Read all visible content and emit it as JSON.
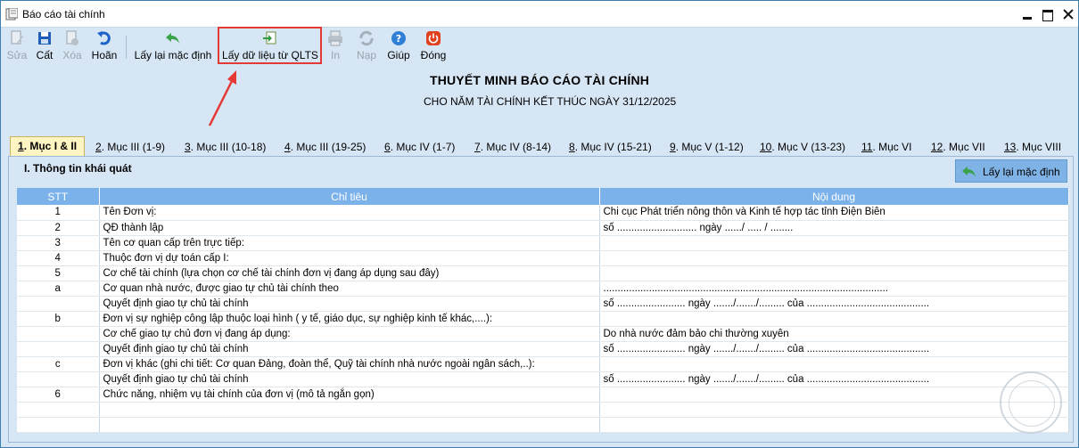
{
  "window": {
    "title": "Báo cáo tài chính"
  },
  "toolbar": {
    "edit": "Sửa",
    "save": "Cất",
    "delete": "Xóa",
    "undo": "Hoãn",
    "reset_default": "Lấy lại mặc định",
    "import_qlts": "Lấy dữ liệu từ QLTS",
    "print": "In",
    "load": "Nạp",
    "help": "Giúp",
    "close": "Đóng"
  },
  "report": {
    "title": "THUYẾT MINH BÁO CÁO TÀI CHÍNH",
    "subtitle": "CHO NĂM TÀI CHÍNH KẾT THÚC NGÀY 31/12/2025"
  },
  "tabs": [
    {
      "key": "1",
      "label": ". Mục I & II"
    },
    {
      "key": "2",
      "label": ". Mục III (1-9)"
    },
    {
      "key": "3",
      "label": ". Mục III (10-18)"
    },
    {
      "key": "4",
      "label": ". Mục III (19-25)"
    },
    {
      "key": "6",
      "label": ". Mục IV (1-7)"
    },
    {
      "key": "7",
      "label": ". Mục IV (8-14)"
    },
    {
      "key": "8",
      "label": ". Mục IV (15-21)"
    },
    {
      "key": "9",
      "label": ". Mục V (1-12)"
    },
    {
      "key": "10",
      "label": ". Mục V (13-23)"
    },
    {
      "key": "11",
      "label": ". Mục VI"
    },
    {
      "key": "12",
      "label": ". Mục VII"
    },
    {
      "key": "13",
      "label": ". Mục VIII"
    }
  ],
  "section": {
    "title": "I. Thông tin khái quát",
    "reset_button": "Lấy lại mặc định"
  },
  "table": {
    "headers": {
      "stt": "STT",
      "indicator": "Chỉ tiêu",
      "content": "Nội dung"
    },
    "rows": [
      {
        "stt": "1",
        "indicator": "Tên Đơn vị:",
        "content": "Chi cục Phát triển nông thôn và Kinh tế hợp tác tỉnh Điện Biên"
      },
      {
        "stt": "2",
        "indicator": "QĐ thành lập",
        "content": "số ............................ ngày ....../ ..... / ........"
      },
      {
        "stt": "3",
        "indicator": "Tên cơ quan cấp trên trực tiếp:",
        "content": ""
      },
      {
        "stt": "4",
        "indicator": "Thuộc đơn vị dự toán cấp I:",
        "content": ""
      },
      {
        "stt": "5",
        "indicator": "Cơ chế tài chính (lựa chọn cơ chế tài chính đơn vị đang áp dụng sau đây)",
        "content": ""
      },
      {
        "stt": "a",
        "indicator": "Cơ quan nhà nước, được giao tự chủ tài chính theo",
        "content": "...................................................................................................."
      },
      {
        "stt": "",
        "indicator": "Quyết định giao tự chủ tài chính",
        "content": "số ........................ ngày ......./......./......... của ..........................................."
      },
      {
        "stt": "b",
        "indicator": "Đơn vị sự nghiệp công lập thuộc loại hình ( y tế, giáo dục, sự nghiệp kinh tế khác,....):",
        "content": ""
      },
      {
        "stt": "",
        "indicator": "Cơ chế giao tự chủ đơn vị đang áp dụng:",
        "content": "Do nhà nước đảm bảo chi thường xuyên"
      },
      {
        "stt": "",
        "indicator": "Quyết định giao tự chủ tài chính",
        "content": "số ........................ ngày ......./......./......... của ..........................................."
      },
      {
        "stt": "c",
        "indicator": "Đơn vị khác (ghi chi tiết: Cơ quan Đảng, đoàn thể, Quỹ tài chính nhà nước ngoài ngân sách,..):",
        "content": ""
      },
      {
        "stt": "",
        "indicator": "Quyết định giao tự chủ tài chính",
        "content": "số ........................ ngày ......./......./......... của ..........................................."
      },
      {
        "stt": "6",
        "indicator": "Chức năng, nhiệm vụ tài chính của đơn vị (mô tả ngắn gọn)",
        "content": ""
      }
    ]
  }
}
